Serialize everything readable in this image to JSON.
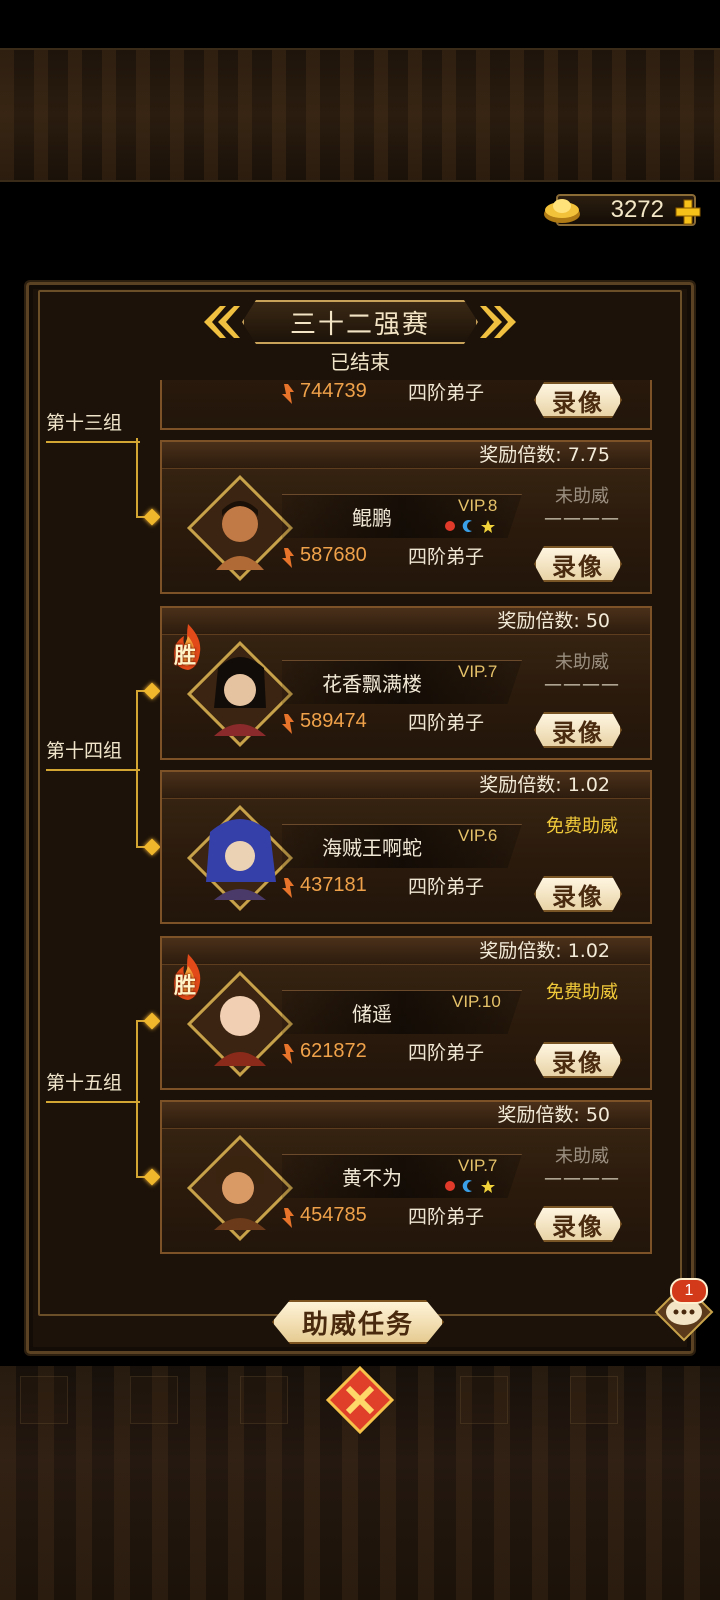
{
  "currency": {
    "value": "3272",
    "icon": "gold-ingot-icon"
  },
  "header": {
    "title": "三十二强赛",
    "status": "已结束"
  },
  "groups": [
    {
      "label": "第十三组"
    },
    {
      "label": "第十四组"
    },
    {
      "label": "第十五组"
    }
  ],
  "partial_card": {
    "power": "744739",
    "rank": "四阶弟子",
    "replay": "录像"
  },
  "cards": [
    {
      "reward": "奖励倍数: 7.75",
      "name": "鲲鹏",
      "vip": "VIP.8",
      "power": "587680",
      "rank": "四阶弟子",
      "support": "未助威",
      "dashes": "————",
      "replay": "录像",
      "win": ""
    },
    {
      "reward": "奖励倍数: 50",
      "name": "花香飘满楼",
      "vip": "VIP.7",
      "power": "589474",
      "rank": "四阶弟子",
      "support": "未助威",
      "dashes": "————",
      "replay": "录像",
      "win": "胜"
    },
    {
      "reward": "奖励倍数: 1.02",
      "name": "海贼王啊蛇",
      "vip": "VIP.6",
      "power": "437181",
      "rank": "四阶弟子",
      "support": "免费助威",
      "dashes": "",
      "replay": "录像",
      "win": ""
    },
    {
      "reward": "奖励倍数: 1.02",
      "name": "储遥",
      "vip": "VIP.10",
      "power": "621872",
      "rank": "四阶弟子",
      "support": "免费助威",
      "dashes": "",
      "replay": "录像",
      "win": "胜"
    },
    {
      "reward": "奖励倍数: 50",
      "name": "黄不为",
      "vip": "VIP.7",
      "power": "454785",
      "rank": "四阶弟子",
      "support": "未助威",
      "dashes": "————",
      "replay": "录像",
      "win": ""
    }
  ],
  "footer": {
    "task_button": "助威任务",
    "chat_badge": "1"
  },
  "colors": {
    "accent_gold": "#d3a533",
    "power_orange": "#f0a24a",
    "free_support": "#f0c93a",
    "panel_bg": "#1c1209"
  }
}
